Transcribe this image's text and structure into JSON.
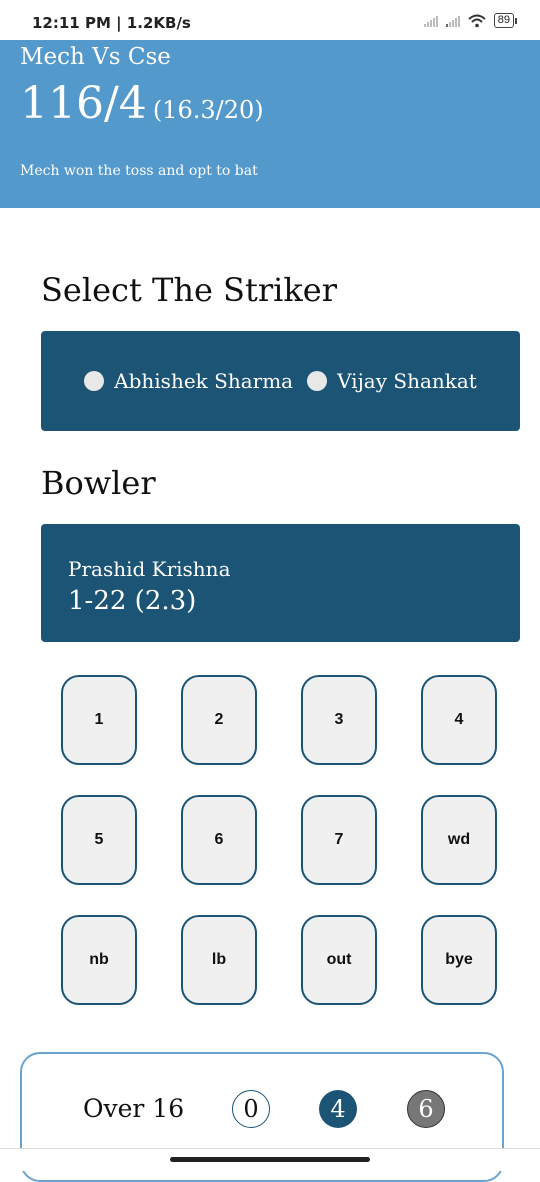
{
  "status_bar": {
    "time_speed": "12:11 PM | 1.2KB/s",
    "battery": "89"
  },
  "header": {
    "match_title": "Mech Vs Cse",
    "score": "116/4",
    "overs": "(16.3/20)",
    "toss_info": "Mech won the toss and opt to bat"
  },
  "striker_section": {
    "heading": "Select The Striker",
    "options": [
      "Abhishek Sharma",
      "Vijay Shankat"
    ]
  },
  "bowler_section": {
    "heading": "Bowler",
    "name": "Prashid Krishna",
    "figures": "1-22 (2.3)"
  },
  "keypad": {
    "keys": [
      "1",
      "2",
      "3",
      "4",
      "5",
      "6",
      "7",
      "wd",
      "nb",
      "lb",
      "out",
      "bye"
    ]
  },
  "current_over": {
    "label": "Over 16",
    "balls": [
      {
        "value": "0",
        "style": "outline"
      },
      {
        "value": "4",
        "style": "boundary"
      },
      {
        "value": "6",
        "style": "six"
      }
    ],
    "colors": {
      "boundary": "#1c5476",
      "six": "#777777"
    }
  },
  "colors": {
    "header_bg": "#5499cc",
    "panel_bg": "#1c5476"
  }
}
